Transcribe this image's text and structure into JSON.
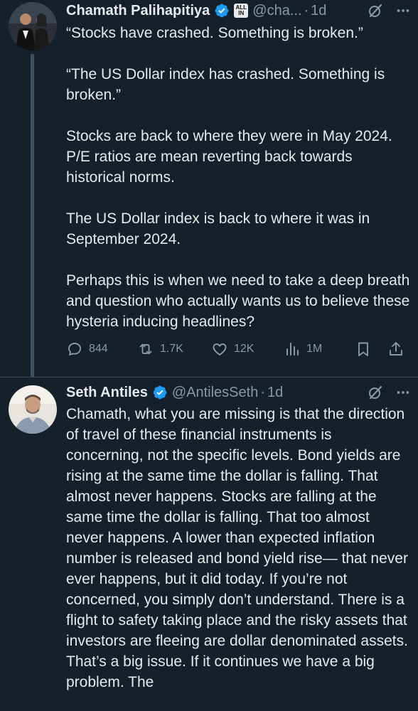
{
  "colors": {
    "background": "#15202b",
    "text": "#e7e9ea",
    "muted": "#8b98a5",
    "verified": "#1d9bf0",
    "thread_line": "#3e5060"
  },
  "tweet1": {
    "name": "Chamath Palihapitiya",
    "badge_line1": "ALL",
    "badge_line2": "IN",
    "handle": "@cha...",
    "dot": "·",
    "time": "1d",
    "body": "“Stocks have crashed. Something is broken.”\n\n“The US Dollar index has crashed. Something is broken.”\n\nStocks are back to where they were in May 2024. P/E ratios are mean reverting back towards historical norms.\n\nThe US Dollar index is back to where it was in September 2024.\n\nPerhaps this is when we need to take a deep breath and question who actually wants us to believe these hysteria inducing headlines?",
    "actions": {
      "replies": "844",
      "reposts": "1.7K",
      "likes": "12K",
      "views": "1M"
    },
    "icons": [
      "verified-icon",
      "all-in-badge",
      "grok-icon",
      "more-icon",
      "reply-icon",
      "repost-icon",
      "like-icon",
      "views-icon",
      "bookmark-icon",
      "share-icon"
    ]
  },
  "tweet2": {
    "name": "Seth Antiles",
    "handle": "@AntilesSeth",
    "dot": "·",
    "time": "1d",
    "body": "Chamath, what you are missing is that the direction of travel of these financial instruments is concerning, not the specific levels. Bond yields are rising at the same time the dollar is falling. That almost never happens. Stocks are falling at the same time the dollar is falling. That too almost never happens. A lower than expected inflation number is released and bond yield rise— that never ever happens, but it did today. If you’re not concerned, you simply don’t understand. There is a flight to safety taking place and the risky assets that investors are fleeing are dollar denominated assets. That’s a big issue. If it continues we have a big problem. The",
    "icons": [
      "verified-icon",
      "grok-icon",
      "more-icon"
    ]
  }
}
